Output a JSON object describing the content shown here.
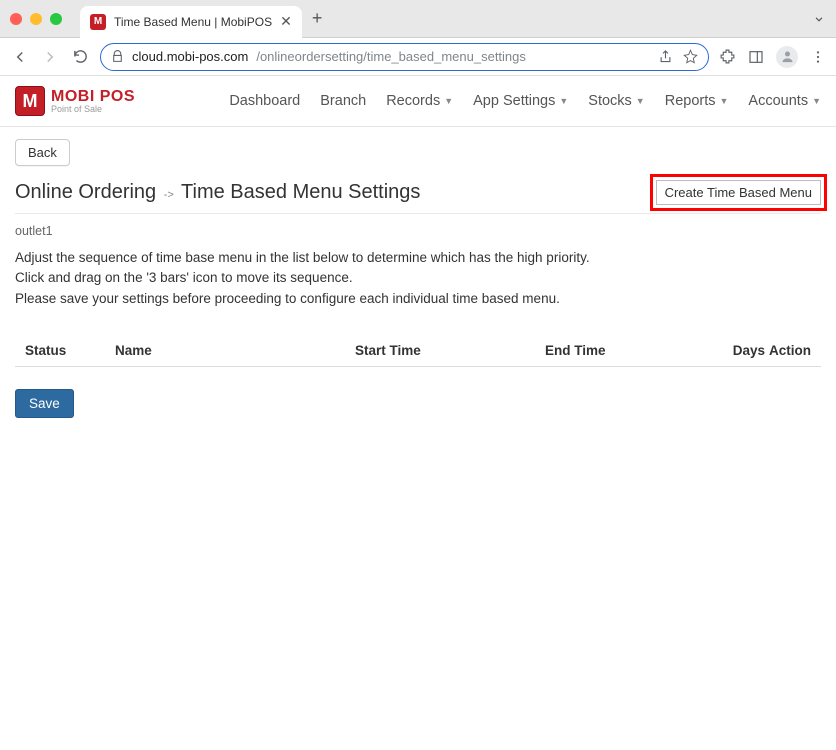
{
  "browser": {
    "tab_title": "Time Based Menu | MobiPOS",
    "url_domain": "cloud.mobi-pos.com",
    "url_path": "/onlineordersetting/time_based_menu_settings"
  },
  "logo": {
    "main": "MOBI POS",
    "sub": "Point of Sale",
    "badge": "M"
  },
  "nav": {
    "items": [
      {
        "label": "Dashboard",
        "dropdown": false
      },
      {
        "label": "Branch",
        "dropdown": false
      },
      {
        "label": "Records",
        "dropdown": true
      },
      {
        "label": "App Settings",
        "dropdown": true
      },
      {
        "label": "Stocks",
        "dropdown": true
      },
      {
        "label": "Reports",
        "dropdown": true
      },
      {
        "label": "Accounts",
        "dropdown": true
      }
    ]
  },
  "buttons": {
    "back": "Back",
    "create": "Create Time Based Menu",
    "save": "Save"
  },
  "breadcrumb": {
    "parent": "Online Ordering",
    "current": "Time Based Menu Settings"
  },
  "outlet": "outlet1",
  "instructions": [
    "Adjust the sequence of time base menu in the list below to determine which has the high priority.",
    "Click and drag on the '3 bars' icon to move its sequence.",
    "Please save your settings before proceeding to configure each individual time based menu."
  ],
  "table": {
    "columns": {
      "status": "Status",
      "name": "Name",
      "start": "Start Time",
      "end": "End Time",
      "days": "Days",
      "action": "Action"
    },
    "rows": []
  }
}
